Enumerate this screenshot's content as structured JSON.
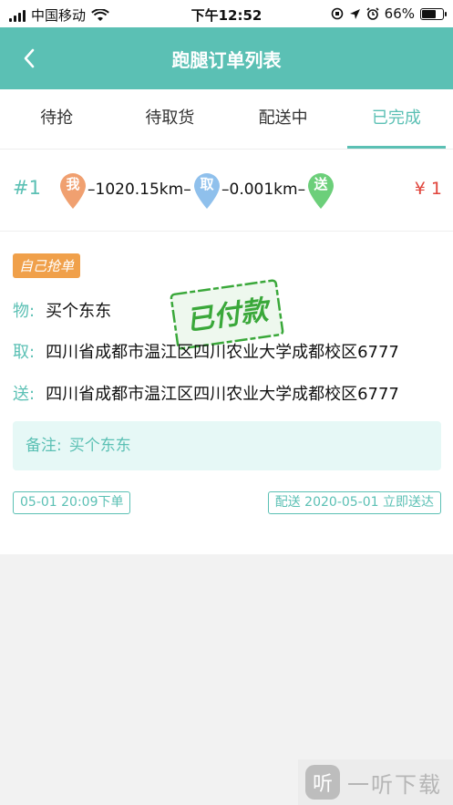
{
  "status_bar": {
    "carrier": "中国移动",
    "time": "下午12:52",
    "battery": "66%",
    "battery_level": 0.66
  },
  "nav": {
    "title": "跑腿订单列表"
  },
  "tabs": [
    {
      "label": "待抢"
    },
    {
      "label": "待取货"
    },
    {
      "label": "配送中"
    },
    {
      "label": "已完成",
      "active": true
    }
  ],
  "order": {
    "number": "#1",
    "pins": {
      "me": "我",
      "pickup": "取",
      "deliver": "送"
    },
    "distance_to_pickup": "–1020.15km–",
    "distance_to_deliver": "–0.001km–",
    "price": "¥ 1",
    "badge": "自己抢单",
    "stamp": "已付款",
    "item_label": "物:",
    "item": "买个东东",
    "pickup_label": "取:",
    "pickup_address": "四川省成都市温江区四川农业大学成都校区6777",
    "deliver_label": "送:",
    "deliver_address": "四川省成都市温江区四川农业大学成都校区6777",
    "remark_label": "备注:",
    "remark": "买个东东",
    "order_time": "05-01 20:09下单",
    "delivery_time": "配送 2020-05-01 立即送达"
  },
  "watermark": {
    "text": "一听下载",
    "logo_char": "听"
  },
  "colors": {
    "primary": "#5bc0b4",
    "price": "#e0443b",
    "badge": "#f0a04a",
    "pin_me": "#f0a070",
    "pin_pickup": "#8fc0ec",
    "pin_deliver": "#6ccf7a",
    "stamp": "#3aa83a"
  }
}
